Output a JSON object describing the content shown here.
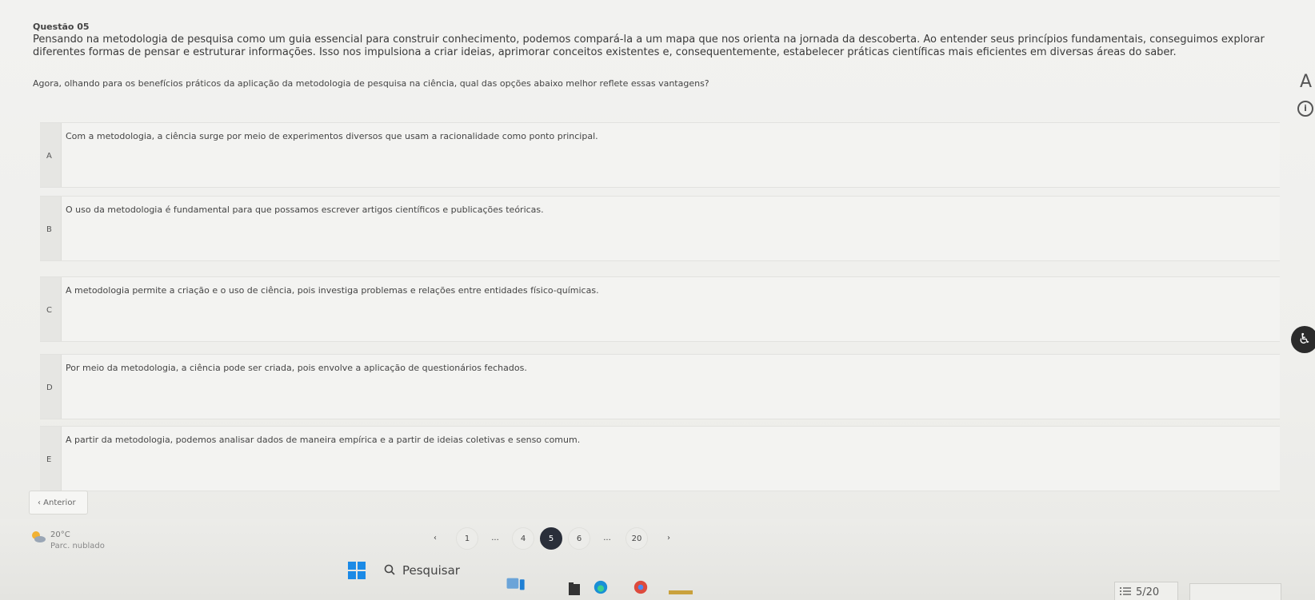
{
  "question": {
    "title": "Questão 05",
    "statement": "Pensando na metodologia de pesquisa como um guia essencial para construir conhecimento, podemos compará-la a um mapa que nos orienta na jornada da descoberta. Ao entender seus princípios fundamentais, conseguimos explorar diferentes formas de pensar e estruturar informações. Isso nos impulsiona a criar ideias, aprimorar conceitos existentes e, consequentemente, estabelecer práticas científicas mais eficientes em diversas áreas do saber.",
    "prompt": "Agora, olhando para os benefícios práticos da aplicação da metodologia de pesquisa na ciência, qual das opções abaixo melhor reflete essas vantagens?"
  },
  "side_tools": {
    "font_label": "A",
    "info_label": "i",
    "accessibility_label": "♿"
  },
  "options": [
    {
      "letter": "A",
      "text": "Com a metodologia, a ciência surge por meio de experimentos diversos que usam a racionalidade como ponto principal."
    },
    {
      "letter": "B",
      "text": "O uso da metodologia é fundamental para que possamos escrever artigos científicos e publicações teóricas."
    },
    {
      "letter": "C",
      "text": "A metodologia permite a criação e o uso de ciência, pois investiga problemas e relações entre entidades físico-químicas."
    },
    {
      "letter": "D",
      "text": "Por meio da metodologia, a ciência pode ser criada, pois envolve a aplicação de questionários fechados."
    },
    {
      "letter": "E",
      "text": "A partir da metodologia, podemos analisar dados de maneira empírica e a partir de ideias coletivas e senso comum."
    }
  ],
  "navigation": {
    "prev_label": "‹  Anterior",
    "pages": [
      "‹",
      "1",
      "...",
      "4",
      "5",
      "6",
      "...",
      "20",
      "›"
    ],
    "active_page": "5"
  },
  "weather": {
    "temp": "20°C",
    "desc": "Parc. nublado"
  },
  "taskbar": {
    "search_label": "Pesquisar",
    "counter": "5/20"
  },
  "colors": {
    "active_page_bg": "#2a2f3a",
    "windows_blue": "#1b8ae6"
  }
}
